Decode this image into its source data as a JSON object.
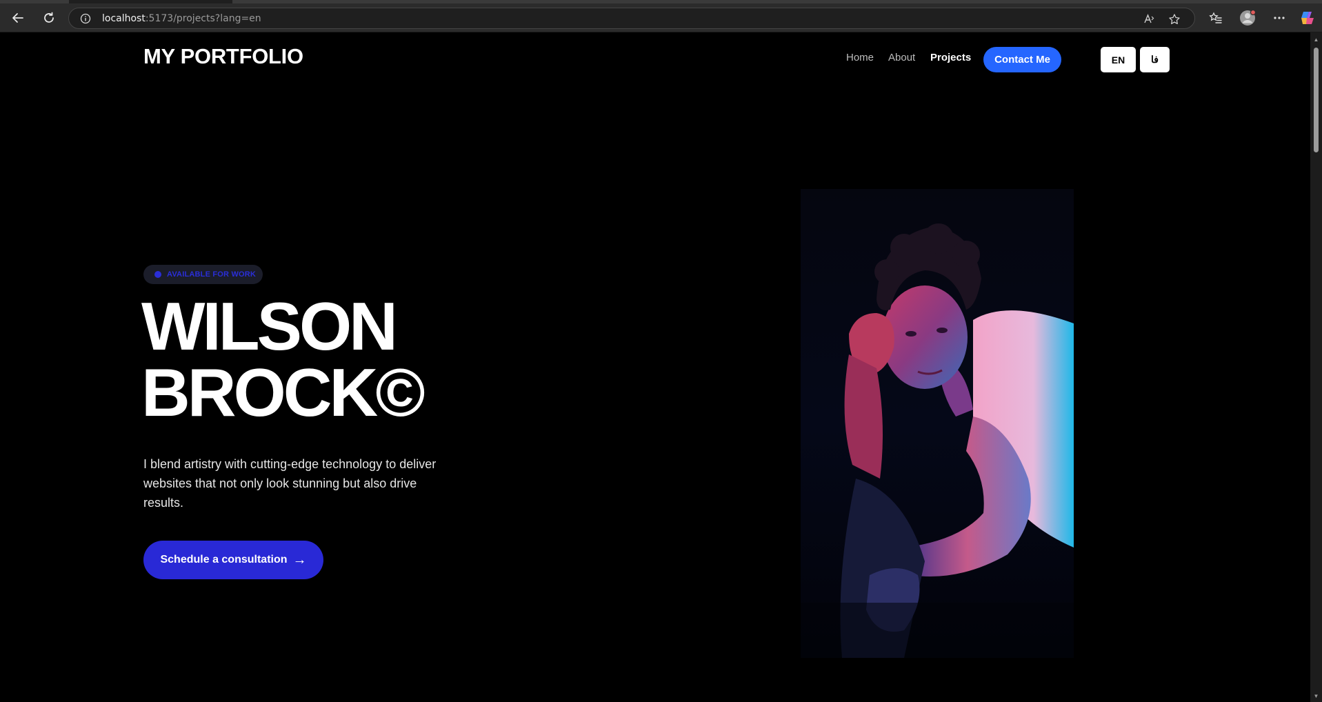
{
  "browser": {
    "url_host": "localhost",
    "url_rest": ":5173/projects?lang=en"
  },
  "header": {
    "logo": "MY PORTFOLIO",
    "nav": [
      {
        "label": "Home",
        "active": false
      },
      {
        "label": "About",
        "active": false
      },
      {
        "label": "Projects",
        "active": true
      }
    ],
    "contact_label": "Contact Me",
    "languages": [
      "EN",
      "فا"
    ]
  },
  "hero": {
    "badge": "AVAILABLE FOR WORK",
    "title_line1": "WILSON",
    "title_line2": "BROCK©",
    "description": "I blend artistry with cutting-edge technology to deliver websites that not only look stunning but also drive results.",
    "cta_label": "Schedule a consultation",
    "cta_arrow": "→"
  },
  "colors": {
    "accent_blue": "#2566ff",
    "cta_blue": "#2929d6",
    "badge_text": "#2a2ed8"
  },
  "icons": [
    "back-icon",
    "reload-icon",
    "info-icon",
    "read-aloud-icon",
    "favorite-star-icon",
    "favorites-list-icon",
    "profile-avatar-icon",
    "more-options-icon",
    "copilot-icon",
    "arrow-right-icon"
  ]
}
